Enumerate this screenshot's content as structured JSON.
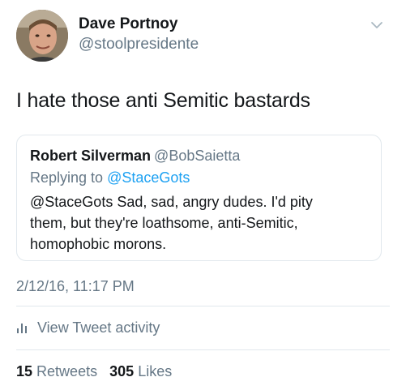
{
  "author": {
    "display_name": "Dave Portnoy",
    "handle": "@stoolpresidente"
  },
  "tweet": {
    "text": "I hate those anti Semitic bastards",
    "timestamp": "2/12/16, 11:17 PM"
  },
  "quoted_tweet": {
    "display_name": "Robert Silverman",
    "handle": "@BobSaietta",
    "replying_label": "Replying to",
    "replying_handle": "@StaceGots",
    "body_lines": [
      "@StaceGots Sad, sad, angry dudes. I'd pity",
      "them, but they're loathsome, anti-Semitic,",
      "homophobic morons."
    ]
  },
  "activity": {
    "label": "View Tweet activity",
    "icon": "bar-chart-icon"
  },
  "stats": {
    "retweets_count": "15",
    "retweets_label": "Retweets",
    "likes_count": "305",
    "likes_label": "Likes"
  },
  "colors": {
    "text": "#14171a",
    "secondary": "#657786",
    "accent": "#1da1f2",
    "border": "#e1e8ed"
  }
}
